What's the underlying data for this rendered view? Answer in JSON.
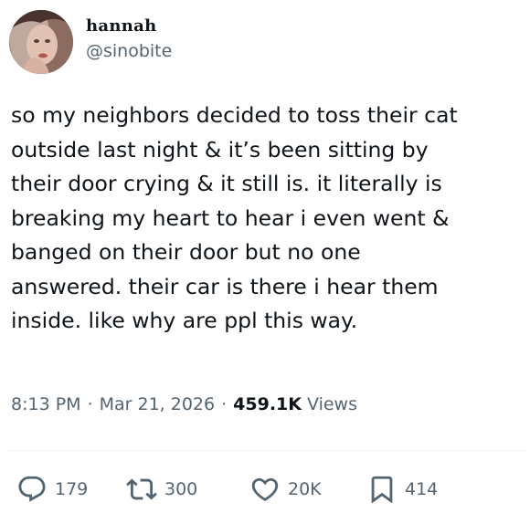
{
  "author": {
    "display_name": "hannah",
    "handle": "@sinobite"
  },
  "tweet": {
    "text": "so my neighbors decided to toss their cat\noutside last night & it’s been sitting by\ntheir door crying & it still is. it literally is\nbreaking my heart to hear i even went &\nbanged on their door but no one\nanswered. their car is there i hear them\ninside. like why are ppl this way."
  },
  "meta": {
    "time": "8:13 PM",
    "separator": "·",
    "date": "Mar 21, 2026",
    "views_count": "459.1K",
    "views_label": "Views"
  },
  "actions": {
    "replies": "179",
    "retweets": "300",
    "likes": "20K",
    "bookmarks": "414"
  },
  "icons": {
    "reply": "reply-icon",
    "retweet": "retweet-icon",
    "like": "heart-icon",
    "bookmark": "bookmark-icon"
  },
  "colors": {
    "text_primary": "#0f1419",
    "text_secondary": "#536471",
    "divider": "#eff3f4"
  }
}
